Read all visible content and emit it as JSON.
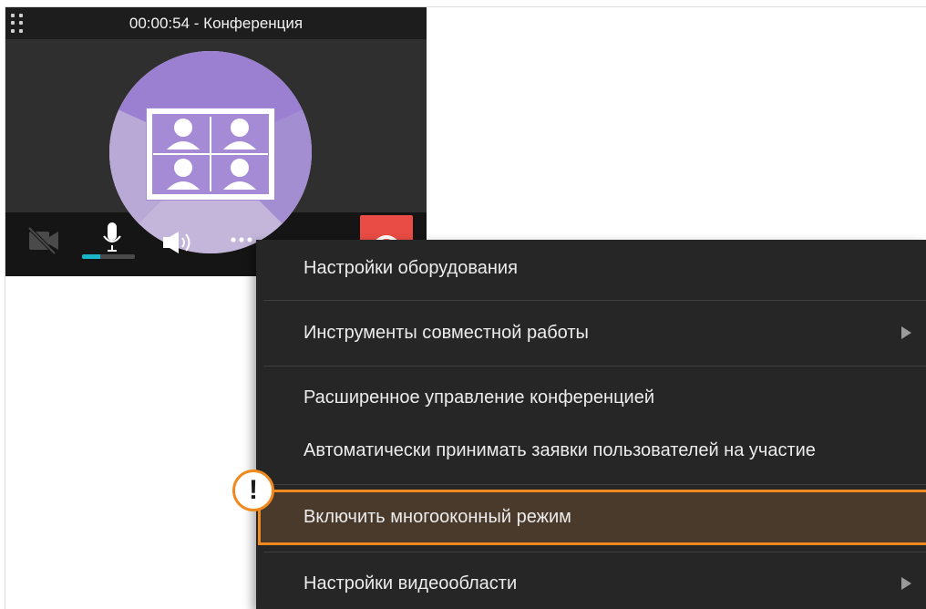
{
  "window": {
    "title": "00:00:54 - Конференция"
  },
  "controls": {
    "camera": {
      "icon": "camera-off-icon",
      "state": "off"
    },
    "microphone": {
      "icon": "microphone-icon",
      "level": 0.35,
      "level_color": "#19b6c9"
    },
    "speaker": {
      "icon": "speaker-icon"
    },
    "more": {
      "icon": "more-dots-icon"
    },
    "hangup": {
      "icon": "hangup-icon",
      "color": "#e84c44"
    }
  },
  "avatar": {
    "icon": "conference-grid-icon",
    "color": "#9b7fd1"
  },
  "menu": {
    "items": [
      {
        "label": "Настройки оборудования",
        "has_submenu": false
      },
      {
        "label": "Инструменты совместной работы",
        "has_submenu": true
      },
      {
        "label": "Расширенное управление конференцией",
        "has_submenu": false
      },
      {
        "label": "Автоматически принимать заявки пользователей на участие",
        "has_submenu": false
      },
      {
        "label": "Включить многооконный режим",
        "has_submenu": false,
        "highlighted": true
      },
      {
        "label": "Настройки видеообласти",
        "has_submenu": true
      }
    ]
  },
  "callout": {
    "text": "!",
    "color": "#f08a1f"
  }
}
